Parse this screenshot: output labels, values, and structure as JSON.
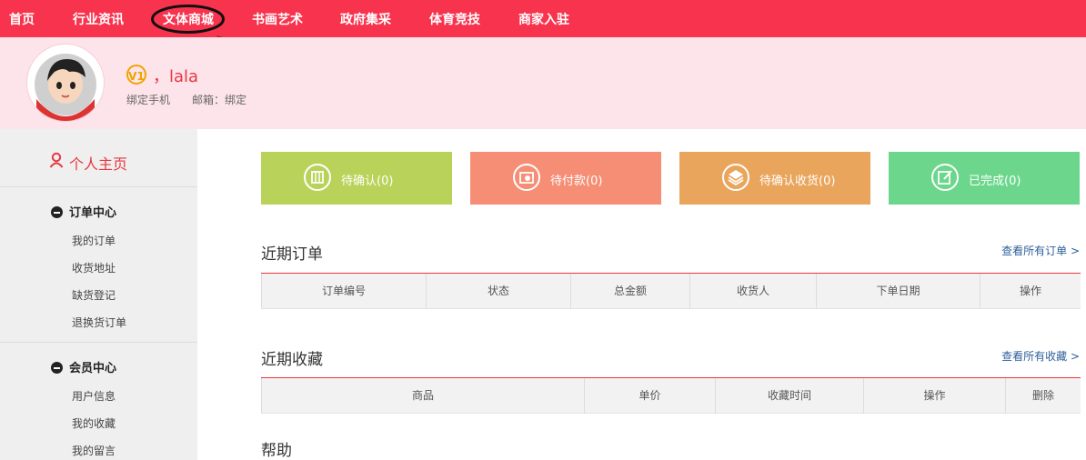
{
  "nav": {
    "items": [
      "首页",
      "行业资讯",
      "文体商城",
      "书画艺术",
      "政府集采",
      "体育竞技",
      "商家入驻"
    ]
  },
  "profile": {
    "level": "V1",
    "greeting": "，lala",
    "bind_phone": "绑定手机",
    "email": "邮箱：绑定"
  },
  "sidebar": {
    "home": "个人主页",
    "order_center": {
      "title": "订单中心",
      "links": [
        "我的订单",
        "收货地址",
        "缺货登记",
        "退换货订单"
      ]
    },
    "member_center": {
      "title": "会员中心",
      "links": [
        "用户信息",
        "我的收藏",
        "我的留言"
      ]
    }
  },
  "status": [
    {
      "label": "待确认(0)",
      "color": "#b9d35a",
      "icon": "bag-icon"
    },
    {
      "label": "待付款(0)",
      "color": "#f58e75",
      "icon": "wallet-icon"
    },
    {
      "label": "待确认收货(0)",
      "color": "#e9a55c",
      "icon": "box-icon"
    },
    {
      "label": "已完成(0)",
      "color": "#6cd78c",
      "icon": "edit-check-icon"
    }
  ],
  "recent_orders": {
    "title": "近期订单",
    "more": "查看所有订单 >",
    "columns": [
      "订单编号",
      "状态",
      "总金额",
      "收货人",
      "下单日期",
      "操作"
    ]
  },
  "recent_favorites": {
    "title": "近期收藏",
    "more": "查看所有收藏 >",
    "columns": [
      "商品",
      "单价",
      "收藏时间",
      "操作",
      "删除"
    ]
  },
  "help": {
    "title": "帮助"
  },
  "colors": {
    "brand_red": "#f7334d",
    "profile_bg": "#fde4ea",
    "sidebar_bg": "#efefef",
    "link_blue": "#2d5f9a"
  }
}
